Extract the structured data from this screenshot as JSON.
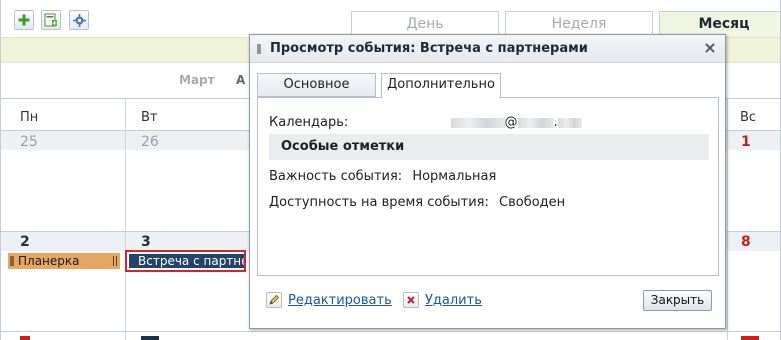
{
  "toolbar": {
    "add": {
      "icon": "plus-icon"
    },
    "add_calendar": {
      "icon": "calendar-add-icon"
    },
    "settings": {
      "icon": "gear-icon"
    }
  },
  "view_tabs": [
    {
      "label": "День",
      "active": false
    },
    {
      "label": "Неделя",
      "active": false
    },
    {
      "label": "Месяц",
      "active": true
    }
  ],
  "months": {
    "prev": "Март",
    "current_initial": "А"
  },
  "grid": {
    "day_names": [
      "Пн",
      "Вт",
      "Вс"
    ],
    "week1_dates": [
      "25",
      "26",
      "1"
    ],
    "week2_dates": [
      "2",
      "3",
      "8"
    ]
  },
  "events": {
    "planerka": "Планерка",
    "meeting": "Встреча с партнер"
  },
  "dialog": {
    "title": "Просмотр события: Встреча с партнерами",
    "close_glyph": "×",
    "tabs": [
      {
        "label": "Основное",
        "active": false
      },
      {
        "label": "Дополнительно",
        "active": true
      }
    ],
    "calendar_label": "Календарь:",
    "calendar_at": "@",
    "calendar_dot": ".",
    "section_title": "Особые отметки",
    "importance_label": "Важность события:",
    "importance_value": "Нормальная",
    "availability_label": "Доступность на время события:",
    "availability_value": "Свободен",
    "edit_label": "Редактировать",
    "delete_label": "Удалить",
    "close_button": "Закрыть"
  },
  "colors": {
    "accent_green": "#eef3d9",
    "event_orange": "#e7a763",
    "event_navy": "#25426a",
    "highlight_red": "#d2242a",
    "weekend_red": "#c8201b",
    "link_blue": "#1e55a5"
  }
}
